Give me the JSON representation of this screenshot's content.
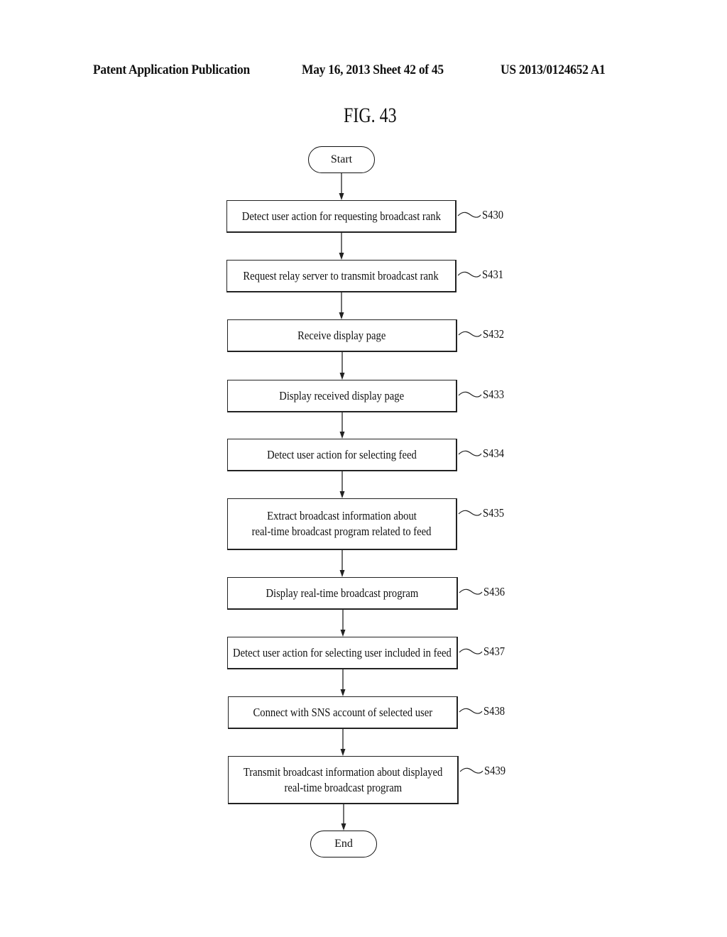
{
  "header": {
    "left": "Patent Application Publication",
    "middle": "May 16, 2013  Sheet 42 of 45",
    "right": "US 2013/0124652 A1"
  },
  "figure": {
    "title": "FIG. 43",
    "start_label": "Start",
    "end_label": "End",
    "steps": [
      {
        "id": "S430",
        "lines": [
          "Detect user action for requesting broadcast rank"
        ]
      },
      {
        "id": "S431",
        "lines": [
          "Request relay server to transmit broadcast rank"
        ]
      },
      {
        "id": "S432",
        "lines": [
          "Receive display page"
        ]
      },
      {
        "id": "S433",
        "lines": [
          "Display received display page"
        ]
      },
      {
        "id": "S434",
        "lines": [
          "Detect user action for selecting feed"
        ]
      },
      {
        "id": "S435",
        "lines": [
          "Extract broadcast information about",
          "real-time broadcast program related to feed"
        ]
      },
      {
        "id": "S436",
        "lines": [
          "Display real-time broadcast program"
        ]
      },
      {
        "id": "S437",
        "lines": [
          "Detect user action for selecting user included in feed"
        ]
      },
      {
        "id": "S438",
        "lines": [
          "Connect with SNS account of selected user"
        ]
      },
      {
        "id": "S439",
        "lines": [
          "Transmit broadcast information about displayed",
          "real-time broadcast program"
        ]
      }
    ]
  }
}
